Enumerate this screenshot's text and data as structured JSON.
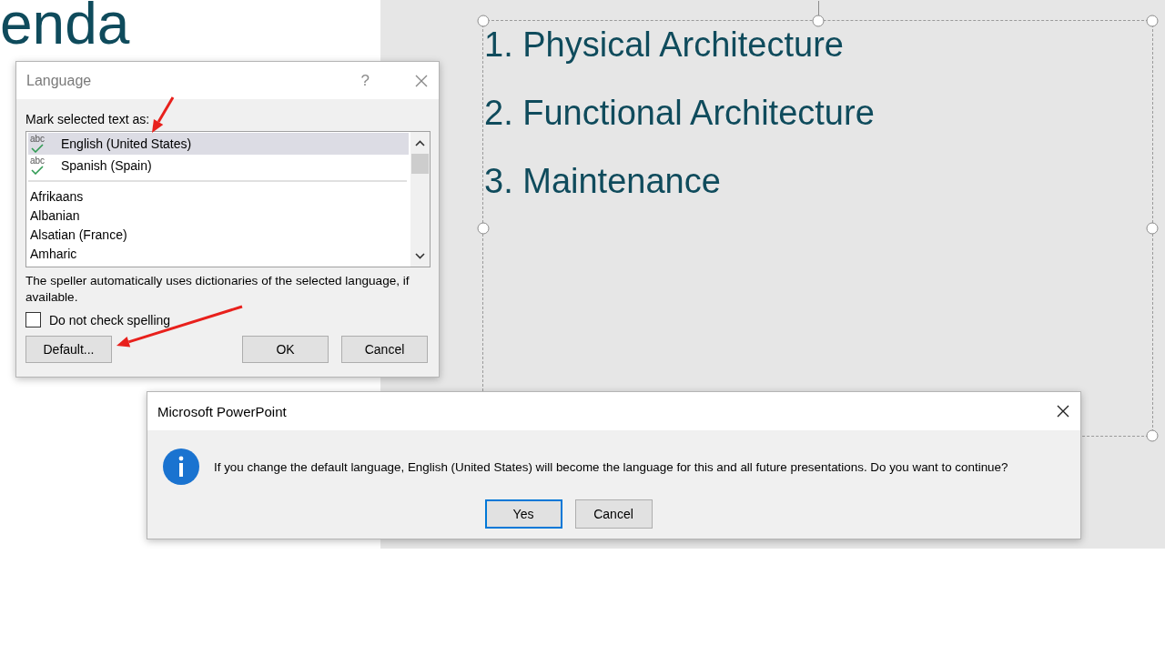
{
  "slide": {
    "title": "enda",
    "agenda": [
      {
        "number": "1.",
        "text": "Physical Architecture"
      },
      {
        "number": "2.",
        "text": "Functional Architecture"
      },
      {
        "number": "3.",
        "text": "Maintenance"
      }
    ]
  },
  "language_dialog": {
    "title": "Language",
    "help": "?",
    "prompt": "Mark selected text as:",
    "recent": [
      {
        "badge": "abc",
        "label": "English (United States)",
        "selected": true
      },
      {
        "badge": "abc",
        "label": "Spanish (Spain)",
        "selected": false
      }
    ],
    "languages": [
      {
        "label": "Afrikaans",
        "selected": false
      },
      {
        "label": "Albanian",
        "selected": false
      },
      {
        "label": "Alsatian (France)",
        "selected": false
      },
      {
        "label": "Amharic",
        "selected": false
      }
    ],
    "note": "The speller automatically uses dictionaries of the selected language, if available.",
    "no_spelling_check": {
      "label": "Do not check spelling",
      "checked": false
    },
    "buttons": [
      {
        "label": "Default...",
        "default": false
      },
      {
        "label": "OK",
        "default": false
      },
      {
        "label": "Cancel",
        "default": false
      }
    ]
  },
  "message_box": {
    "title": "Microsoft PowerPoint",
    "message": "If you change the default language, English (United States) will become the language for this and all future presentations. Do you want to continue?",
    "buttons": [
      {
        "label": "Yes",
        "default": true
      },
      {
        "label": "Cancel",
        "default": false
      }
    ]
  }
}
